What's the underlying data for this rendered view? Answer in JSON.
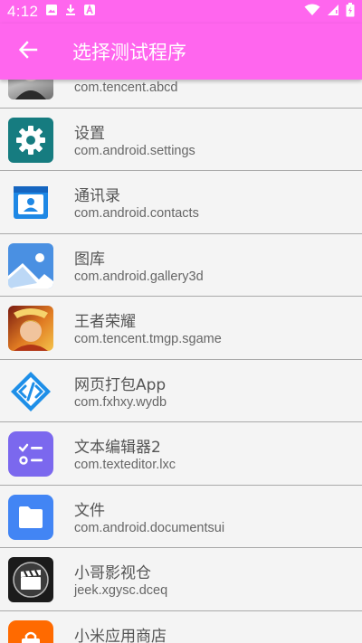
{
  "status_bar": {
    "time": "4:12"
  },
  "app_bar": {
    "title": "选择测试程序"
  },
  "apps": [
    {
      "name": "",
      "package": "com.tencent.abcd",
      "icon": "avatar-photo-icon"
    },
    {
      "name": "设置",
      "package": "com.android.settings",
      "icon": "settings-gear-icon"
    },
    {
      "name": "通讯录",
      "package": "com.android.contacts",
      "icon": "contacts-icon"
    },
    {
      "name": "图库",
      "package": "com.android.gallery3d",
      "icon": "gallery-icon"
    },
    {
      "name": "王者荣耀",
      "package": "com.tencent.tmgp.sgame",
      "icon": "game-icon"
    },
    {
      "name": "网页打包App",
      "package": "com.fxhxy.wydb",
      "icon": "code-brackets-icon"
    },
    {
      "name": "文本编辑器2",
      "package": "com.texteditor.lxc",
      "icon": "checklist-icon"
    },
    {
      "name": "文件",
      "package": "com.android.documentsui",
      "icon": "folder-icon"
    },
    {
      "name": "小哥影视仓",
      "package": "jeek.xgysc.dceq",
      "icon": "film-clapper-icon"
    },
    {
      "name": "小米应用商店",
      "package": "",
      "icon": "store-bag-icon"
    }
  ],
  "colors": {
    "accent": "#ff66ee",
    "background": "#f4f4f4",
    "divider": "#a9a9a9"
  }
}
